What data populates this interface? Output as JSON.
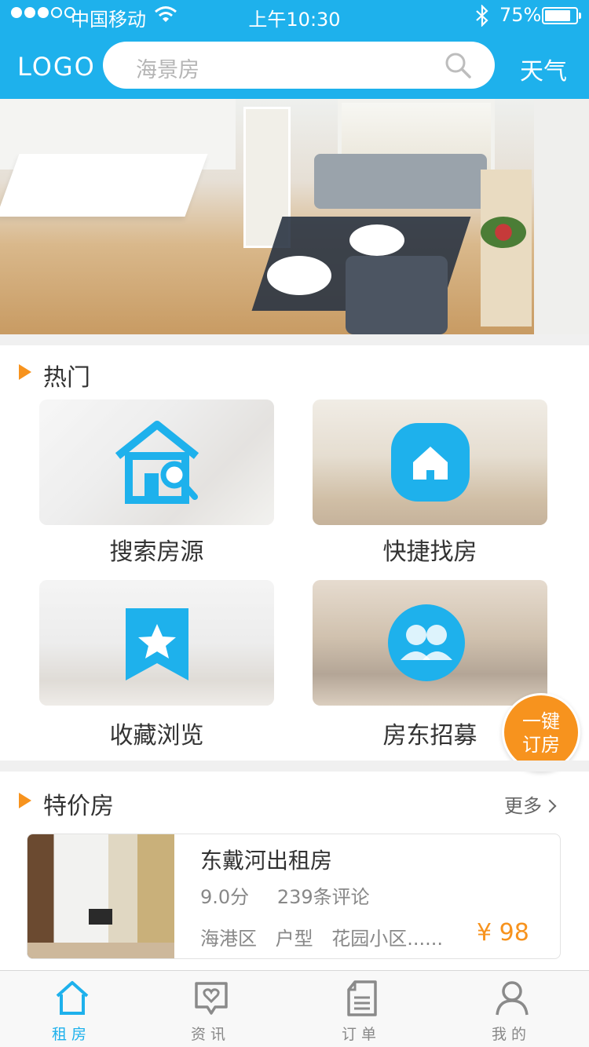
{
  "status_bar": {
    "carrier": "中国移动",
    "time": "上午10:30",
    "battery": "75%"
  },
  "header": {
    "logo": "LOGO",
    "search_placeholder": "海景房",
    "weather_label": "天气"
  },
  "hot_section": {
    "title": "热门",
    "tiles": [
      {
        "label": "搜索房源",
        "icon": "house-search-icon"
      },
      {
        "label": "快捷找房",
        "icon": "house-circle-icon"
      },
      {
        "label": "收藏浏览",
        "icon": "bookmark-star-icon"
      },
      {
        "label": "房东招募",
        "icon": "people-circle-icon"
      }
    ]
  },
  "fab": {
    "line1": "一键",
    "line2": "订房"
  },
  "special_section": {
    "title": "特价房",
    "more_label": "更多",
    "listing": {
      "title": "东戴河出租房",
      "score": "9.0分",
      "reviews": "239条评论",
      "district": "海港区",
      "layout": "户型",
      "community": "花园小区......",
      "price": "¥ 98"
    }
  },
  "tab_bar": {
    "tabs": [
      {
        "label": "租房",
        "icon": "home-icon",
        "active": true
      },
      {
        "label": "资讯",
        "icon": "message-heart-icon",
        "active": false
      },
      {
        "label": "订单",
        "icon": "document-icon",
        "active": false
      },
      {
        "label": "我的",
        "icon": "user-icon",
        "active": false
      }
    ]
  },
  "colors": {
    "primary": "#1eb1ec",
    "accent": "#f7931e"
  }
}
